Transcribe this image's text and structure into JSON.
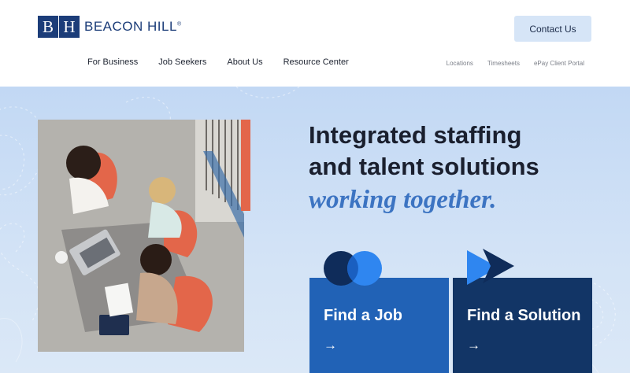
{
  "logo": {
    "mark_left": "B",
    "mark_right": "H",
    "name": "BEACON HILL",
    "reg": "®"
  },
  "header": {
    "contact_label": "Contact Us"
  },
  "main_nav": [
    "For Business",
    "Job Seekers",
    "About Us",
    "Resource Center"
  ],
  "util_nav": [
    "Locations",
    "Timesheets",
    "ePay Client Portal"
  ],
  "hero": {
    "line1": "Integrated staffing",
    "line2": "and talent solutions",
    "line3": "working together."
  },
  "cards": {
    "job": {
      "label": "Find a Job",
      "arrow": "→"
    },
    "solution": {
      "label": "Find a Solution",
      "arrow": "→"
    }
  },
  "colors": {
    "brand_navy": "#1c3d79",
    "hero_bg": "#c2d8f4",
    "job_card": "#2162b6",
    "solution_card": "#123566",
    "accent_orange": "#e3664a",
    "accent_blue_text": "#3c74c2"
  },
  "icons": {
    "job_card_icon": "overlapping-circles-icon",
    "solution_card_icon": "play-arrow-icon",
    "card_arrow": "arrow-right-icon"
  }
}
